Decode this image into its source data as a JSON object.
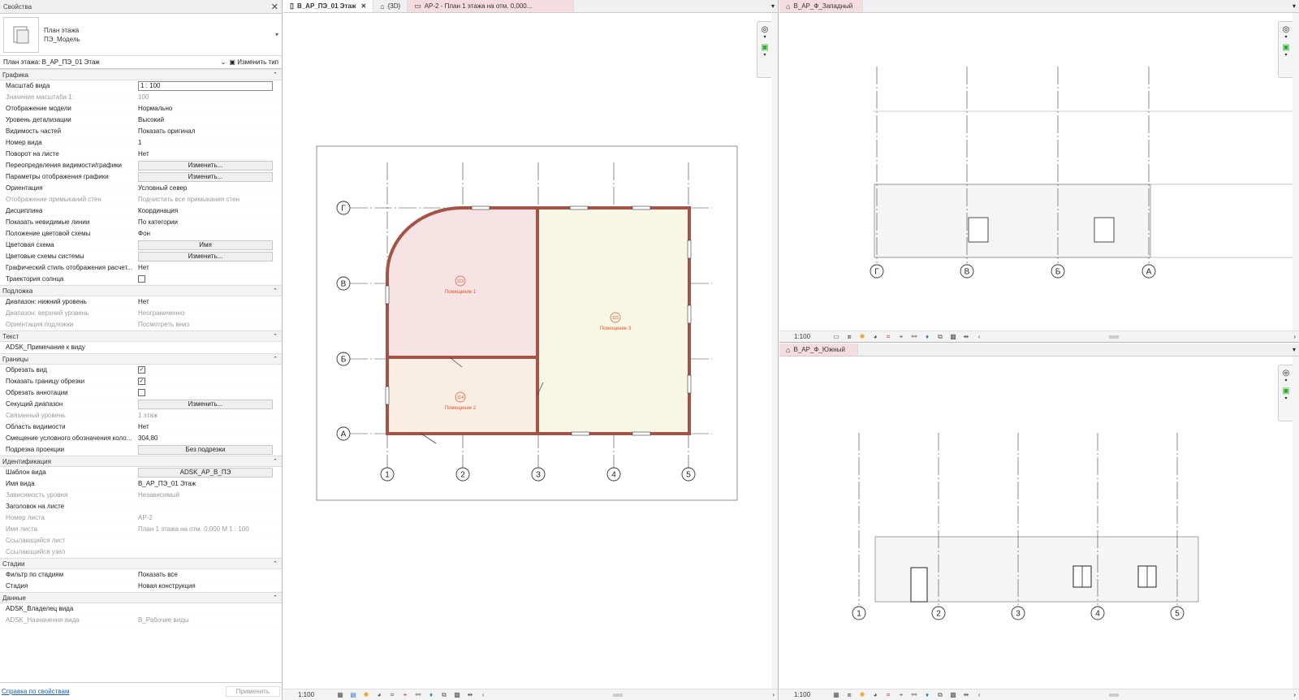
{
  "properties": {
    "title": "Свойства",
    "type_line1": "План этажа",
    "type_line2": "ПЭ_Модель",
    "instance_label": "План этажа: В_АР_ПЭ_01 Этаж",
    "edit_type": "Изменить тип",
    "footer_link": "Справка по свойствам",
    "apply": "Применить",
    "sections": [
      {
        "name": "Графика",
        "rows": [
          {
            "k": "Масштаб вида",
            "v": "1 : 100",
            "t": "inp"
          },
          {
            "k": "Значение масштаба   1:",
            "v": "100",
            "t": "dis"
          },
          {
            "k": "Отображение модели",
            "v": "Нормально"
          },
          {
            "k": "Уровень детализации",
            "v": "Высокий"
          },
          {
            "k": "Видимость частей",
            "v": "Показать оригинал"
          },
          {
            "k": "Номер вида",
            "v": "1"
          },
          {
            "k": "Поворот на листе",
            "v": "Нет"
          },
          {
            "k": "Переопределения видимости/графики",
            "v": "Изменить...",
            "t": "btn"
          },
          {
            "k": "Параметры отображения графики",
            "v": "Изменить...",
            "t": "btn"
          },
          {
            "k": "Ориентация",
            "v": "Условный север"
          },
          {
            "k": "Отображение примыканий стен",
            "v": "Подчистить все примыкания стен",
            "t": "dis"
          },
          {
            "k": "Дисциплина",
            "v": "Координация"
          },
          {
            "k": "Показать невидимые линии",
            "v": "По категории"
          },
          {
            "k": "Положение цветовой схемы",
            "v": "Фон"
          },
          {
            "k": "Цветовая схема",
            "v": "Имя",
            "t": "btn"
          },
          {
            "k": "Цветовые схемы системы",
            "v": "Изменить...",
            "t": "btn"
          },
          {
            "k": "Графический стиль отображения расчет...",
            "v": "Нет"
          },
          {
            "k": "Траектория солнца",
            "v": "",
            "t": "chk0"
          }
        ]
      },
      {
        "name": "Подложка",
        "rows": [
          {
            "k": "Диапазон: нижний уровень",
            "v": "Нет"
          },
          {
            "k": "Диапазон: верхний уровень",
            "v": "Неограниченно",
            "t": "dis"
          },
          {
            "k": "Ориентация подложки",
            "v": "Посмотреть вниз",
            "t": "dis"
          }
        ]
      },
      {
        "name": "Текст",
        "rows": [
          {
            "k": "ADSK_Примечание к виду",
            "v": ""
          }
        ]
      },
      {
        "name": "Границы",
        "rows": [
          {
            "k": "Обрезать вид",
            "v": "",
            "t": "chk1"
          },
          {
            "k": "Показать границу обрезки",
            "v": "",
            "t": "chk1"
          },
          {
            "k": "Обрезать аннотации",
            "v": "",
            "t": "chk0"
          },
          {
            "k": "Секущий диапазон",
            "v": "Изменить...",
            "t": "btn"
          },
          {
            "k": "Связанный уровень",
            "v": "1 этаж",
            "t": "dis"
          },
          {
            "k": "Область видимости",
            "v": "Нет"
          },
          {
            "k": "Смещение условного обозначения коло...",
            "v": "304,80"
          },
          {
            "k": "Подрезка проекции",
            "v": "Без подрезки",
            "t": "btn"
          }
        ]
      },
      {
        "name": "Идентификация",
        "rows": [
          {
            "k": "Шаблон вида",
            "v": "ADSK_АР_В_ПЭ",
            "t": "btn"
          },
          {
            "k": "Имя вида",
            "v": "В_АР_ПЭ_01 Этаж"
          },
          {
            "k": "Зависимость уровня",
            "v": "Независимый",
            "t": "dis"
          },
          {
            "k": "Заголовок на листе",
            "v": ""
          },
          {
            "k": "Номер листа",
            "v": "АР-2",
            "t": "dis"
          },
          {
            "k": "Имя листа",
            "v": "План 1 этажа на отм. 0,000 М 1 : 100",
            "t": "dis"
          },
          {
            "k": "Ссылающийся лист",
            "v": "",
            "t": "dis"
          },
          {
            "k": "Ссылающийся узел",
            "v": "",
            "t": "dis"
          }
        ]
      },
      {
        "name": "Стадии",
        "rows": [
          {
            "k": "Фильтр по стадиям",
            "v": "Показать все"
          },
          {
            "k": "Стадия",
            "v": "Новая конструкция"
          }
        ]
      },
      {
        "name": "Данные",
        "rows": [
          {
            "k": "ADSK_Владелец вида",
            "v": ""
          },
          {
            "k": "ADSK_Назначение вида",
            "v": "В_Рабочие виды",
            "t": "dis"
          }
        ]
      }
    ]
  },
  "tabs": [
    {
      "label": "В_АР_ПЭ_01 Этаж",
      "active": true
    },
    {
      "label": "{3D}"
    },
    {
      "label": "АР-2 - План 1 этажа на отм. 0,000..."
    }
  ],
  "west_tab": "В_АР_Ф_Западный",
  "south_tab": "В_АР_Ф_Южный",
  "scale": "1:100",
  "plan": {
    "grid_rows": [
      "Г",
      "В",
      "Б",
      "А"
    ],
    "grid_cols": [
      "1",
      "2",
      "3",
      "4",
      "5"
    ],
    "rooms": [
      {
        "num": "113",
        "name": "Помещение 1"
      },
      {
        "num": "115",
        "name": "Помещение 3"
      },
      {
        "num": "114",
        "name": "Помещение 2"
      }
    ]
  },
  "west_grid": [
    "Г",
    "В",
    "Б",
    "А"
  ],
  "south_grid": [
    "1",
    "2",
    "3",
    "4",
    "5"
  ],
  "colors": {
    "wall": "#a35446",
    "room1": "#f7e2e4",
    "room2": "#f8eee3",
    "room3": "#f8f7e5",
    "accent": "#e8542b"
  }
}
